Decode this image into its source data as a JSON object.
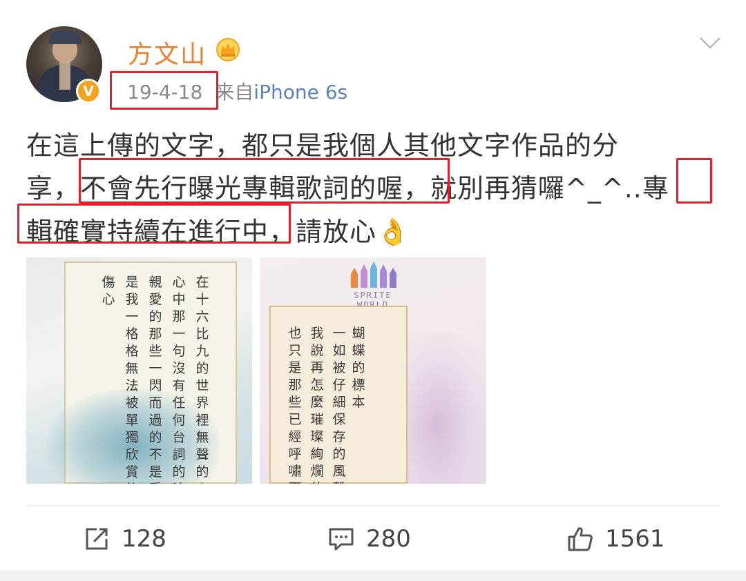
{
  "user": {
    "name": "方文山"
  },
  "meta": {
    "date": "19-4-18",
    "source_prefix": "来自",
    "device": "iPhone 6s"
  },
  "post": {
    "line1": "在這上傳的文字，都只是我個人其他文字作品的分",
    "line2_a": "享，",
    "line2_b": "不會先行曝光專輯歌詞的喔，",
    "line2_c": "就別再猜囉^_^..",
    "line2_d": "專",
    "line3_a": "輯確實持續在進行中",
    "line3_b": "，請放心",
    "emoji": "👌"
  },
  "image1": {
    "columns": [
      "在十六比九的世界裡　無聲的上映",
      "心中那一句　沒有任何台詞　的沈",
      "親愛的　那些一閃而過的　不是愛",
      "是我一格格　無法被單獨欣賞的",
      "傷心"
    ]
  },
  "image2": {
    "logo_text": "SPRITE WORLD",
    "columns": [
      "蝴蝶的標本",
      "一如被仔細保存的風聲",
      "我說　再怎麼璀璨絢爛的",
      "也只是　那些已經呼嘯而"
    ]
  },
  "actions": {
    "repost_count": "128",
    "comment_count": "280",
    "like_count": "1561"
  },
  "colors": {
    "name": "#f07f2c",
    "device_link": "#5b82b6",
    "highlight_box": "#e0202a"
  },
  "icons": [
    "crown-icon",
    "v-verified-badge-icon",
    "chevron-down-icon",
    "repost-icon",
    "comment-icon",
    "like-icon",
    "ok-hand-emoji"
  ]
}
